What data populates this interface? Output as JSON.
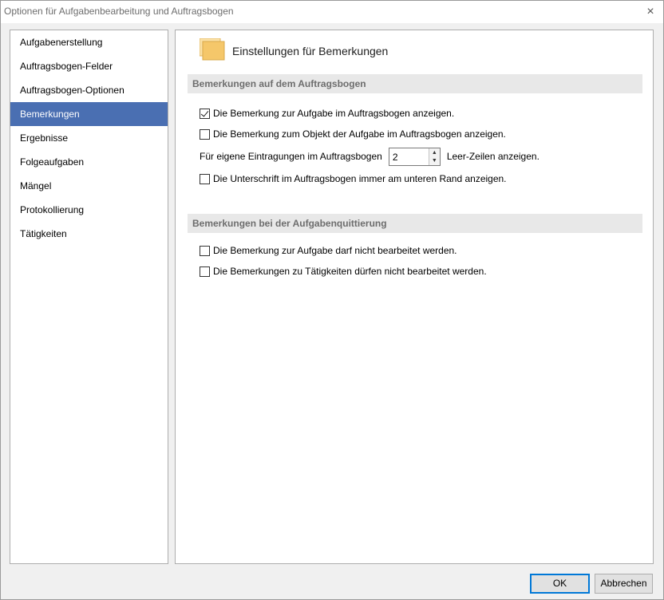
{
  "window": {
    "title": "Optionen für Aufgabenbearbeitung und Auftragsbogen",
    "close_icon": "×"
  },
  "sidebar": {
    "items": [
      {
        "label": "Aufgabenerstellung",
        "active": false
      },
      {
        "label": "Auftragsbogen-Felder",
        "active": false
      },
      {
        "label": "Auftragsbogen-Optionen",
        "active": false
      },
      {
        "label": "Bemerkungen",
        "active": true
      },
      {
        "label": "Ergebnisse",
        "active": false
      },
      {
        "label": "Folgeaufgaben",
        "active": false
      },
      {
        "label": "Mängel",
        "active": false
      },
      {
        "label": "Protokollierung",
        "active": false
      },
      {
        "label": "Tätigkeiten",
        "active": false
      }
    ]
  },
  "main": {
    "title": "Einstellungen für Bemerkungen",
    "sections": [
      {
        "header": "Bemerkungen auf dem Auftragsbogen",
        "options": [
          {
            "label": "Die Bemerkung zur Aufgabe im Auftragsbogen anzeigen.",
            "checked": true
          },
          {
            "label": "Die Bemerkung zum Objekt der Aufgabe im Auftragsbogen anzeigen.",
            "checked": false
          }
        ],
        "spinner": {
          "prefix": "Für eigene Eintragungen im Auftragsbogen",
          "value": "2",
          "suffix": "Leer-Zeilen anzeigen."
        },
        "option_after": {
          "label": "Die Unterschrift im Auftragsbogen immer am unteren Rand anzeigen.",
          "checked": false
        }
      },
      {
        "header": "Bemerkungen bei der Aufgabenquittierung",
        "options": [
          {
            "label": "Die Bemerkung zur Aufgabe darf nicht bearbeitet werden.",
            "checked": false
          },
          {
            "label": "Die Bemerkungen zu Tätigkeiten dürfen nicht bearbeitet werden.",
            "checked": false
          }
        ]
      }
    ]
  },
  "footer": {
    "ok_label": "OK",
    "cancel_label": "Abbrechen"
  },
  "colors": {
    "selection": "#4a6fb2",
    "folder_icon": "#f5c76a"
  }
}
